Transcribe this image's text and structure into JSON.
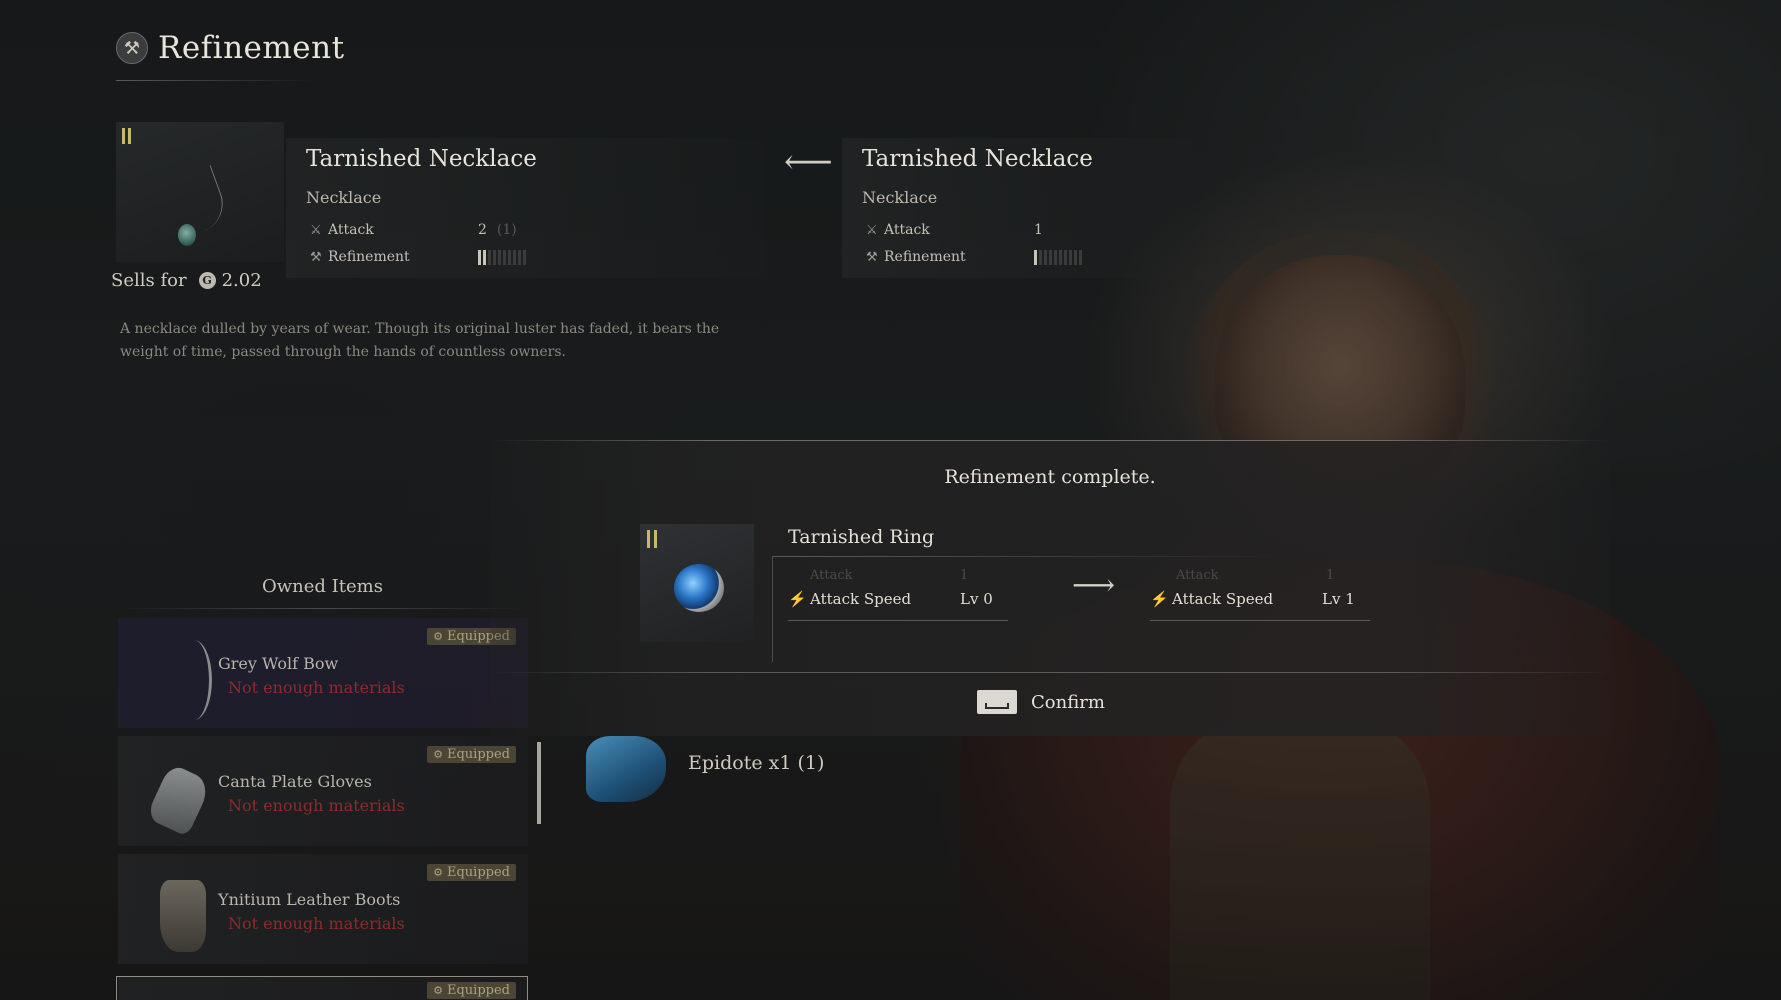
{
  "header": {
    "title": "Refinement",
    "icon": "refinement-hammer-icon"
  },
  "current_item": {
    "name": "Tarnished Necklace",
    "type": "Necklace",
    "attack_label": "Attack",
    "attack_value": "2",
    "attack_ghost": "(1)",
    "refinement_label": "Refinement",
    "refinement_level": 2,
    "refinement_max": 10,
    "sells_label": "Sells for",
    "sells_value": "2.02",
    "description": "A necklace dulled by years of wear. Though its original luster has faded, it bears the weight of time, passed through the hands of countless owners."
  },
  "previous_item": {
    "name": "Tarnished Necklace",
    "type": "Necklace",
    "attack_label": "Attack",
    "attack_value": "1",
    "refinement_label": "Refinement",
    "refinement_level": 1,
    "refinement_max": 10
  },
  "owned_items": {
    "title": "Owned Items",
    "items": [
      {
        "name": "Grey Wolf Bow",
        "status": "Not enough materials",
        "badge": "Equipped"
      },
      {
        "name": "Canta Plate Gloves",
        "status": "Not enough materials",
        "badge": "Equipped"
      },
      {
        "name": "Ynitium Leather Boots",
        "status": "Not enough materials",
        "badge": "Equipped"
      },
      {
        "badge": "Equipped"
      }
    ]
  },
  "modal": {
    "title": "Refinement complete.",
    "item_name": "Tarnished Ring",
    "ghost_stat_label": "Attack",
    "ghost_stat_value": "1",
    "before": {
      "label": "Attack Speed",
      "value": "Lv 0"
    },
    "after": {
      "label": "Attack Speed",
      "value": "Lv 1"
    },
    "confirm_label": "Confirm"
  },
  "material": {
    "label": "Epidote x1 (1)"
  },
  "colors": {
    "accent_gold": "#c7b86a",
    "warning_red": "#8c2c2c",
    "badge_bg": "#4a4535"
  }
}
